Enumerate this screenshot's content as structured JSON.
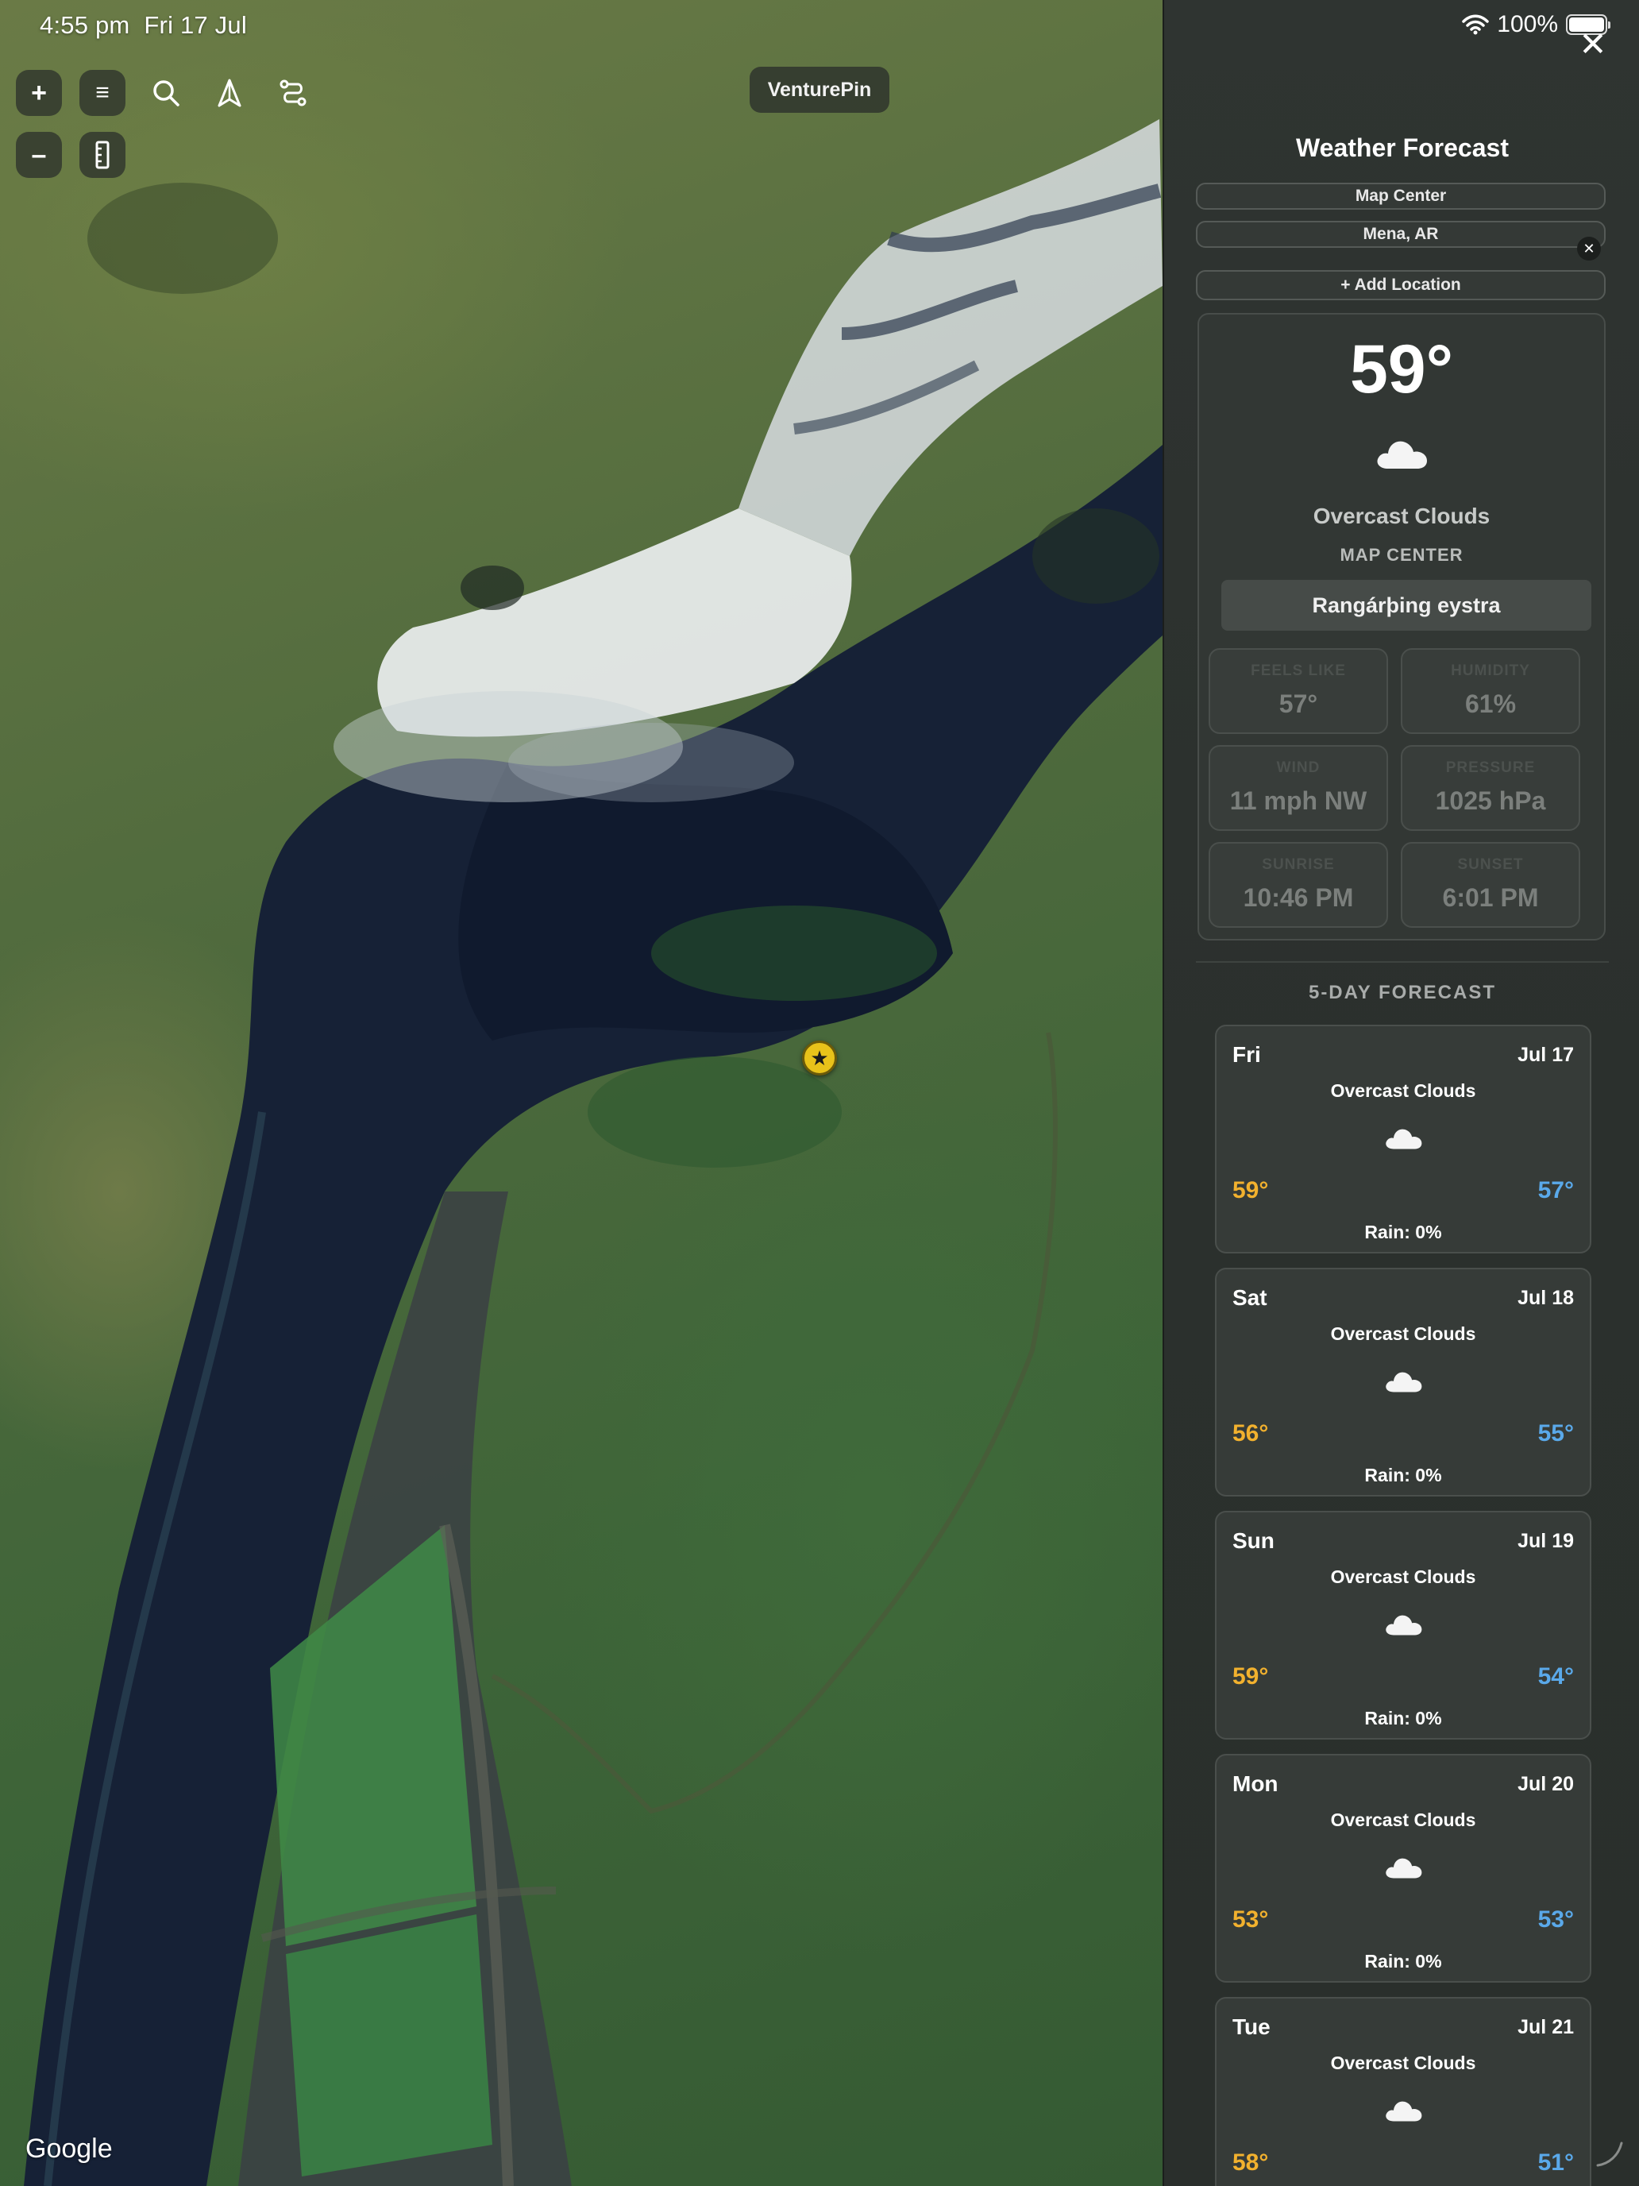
{
  "status_bar": {
    "time": "4:55 pm",
    "date": "Fri 17 Jul",
    "battery": "100%"
  },
  "map": {
    "app_name": "VenturePin",
    "attribution": "Google",
    "controls": {
      "zoom_in": "+",
      "zoom_out": "–",
      "menu": "≡"
    },
    "icons": [
      "plus-icon",
      "menu-icon",
      "search-icon",
      "navigate-icon",
      "route-icon",
      "minus-icon",
      "ruler-icon",
      "star-marker-icon"
    ]
  },
  "panel": {
    "close": "✕",
    "title": "Weather Forecast",
    "locations": [
      "Map Center",
      "Mena, AR"
    ],
    "remove_location": "✕",
    "add_location": "+ Add Location",
    "current": {
      "temperature": "59°",
      "condition": "Overcast Clouds",
      "location_label": "MAP CENTER",
      "region": "Rangárþing eystra",
      "metrics": [
        {
          "label": "FEELS LIKE",
          "value": "57°"
        },
        {
          "label": "HUMIDITY",
          "value": "61%"
        },
        {
          "label": "WIND",
          "value": "11 mph NW"
        },
        {
          "label": "PRESSURE",
          "value": "1025 hPa"
        },
        {
          "label": "SUNRISE",
          "value": "10:46 PM"
        },
        {
          "label": "SUNSET",
          "value": "6:01 PM"
        }
      ]
    },
    "forecast_title": "5-DAY FORECAST",
    "forecast": [
      {
        "day": "Fri",
        "date": "Jul 17",
        "condition": "Overcast Clouds",
        "high": "59°",
        "low": "57°",
        "rain": "Rain: 0%"
      },
      {
        "day": "Sat",
        "date": "Jul 18",
        "condition": "Overcast Clouds",
        "high": "56°",
        "low": "55°",
        "rain": "Rain: 0%"
      },
      {
        "day": "Sun",
        "date": "Jul 19",
        "condition": "Overcast Clouds",
        "high": "59°",
        "low": "54°",
        "rain": "Rain: 0%"
      },
      {
        "day": "Mon",
        "date": "Jul 20",
        "condition": "Overcast Clouds",
        "high": "53°",
        "low": "53°",
        "rain": "Rain: 0%"
      },
      {
        "day": "Tue",
        "date": "Jul 21",
        "condition": "Overcast Clouds",
        "high": "58°",
        "low": "51°",
        "rain": ""
      }
    ]
  },
  "colors": {
    "high_temp": "#f2b12e",
    "low_temp": "#5aa9ea",
    "marker": "#e8c21a"
  }
}
